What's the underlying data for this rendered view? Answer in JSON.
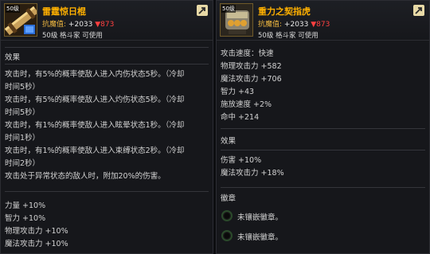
{
  "left": {
    "level_badge": "50级",
    "title": "雷霆惊日棍",
    "score_label": "抗魔值:",
    "score_up": "+2033",
    "score_down": "▼873",
    "requirement": "50级 格斗家 可使用",
    "effect_title": "效果",
    "effect_lines": [
      "攻击时，有5%的概率使敌人进入内伤状态5秒。（冷却",
      "时间5秒）",
      "攻击时，有5%的概率使敌人进入灼伤状态5秒。（冷却",
      "时间5秒）",
      "攻击时，有1%的概率使敌人进入眩晕状态1秒。（冷却",
      "时间1秒）",
      "攻击时，有1%的概率使敌人进入束缚状态2秒。（冷却",
      "时间2秒）",
      "攻击处于异常状态的敌人时，附加20%的伤害。"
    ],
    "stats": [
      "力量 +10%",
      "智力 +10%",
      "物理攻击力 +10%",
      "魔法攻击力 +10%"
    ]
  },
  "right": {
    "level_badge": "50级",
    "title": "重力之契指虎",
    "score_label": "抗魔值:",
    "score_up": "+2033",
    "score_down": "▼873",
    "requirement": "50级 格斗家 可使用",
    "stats": [
      "攻击速度：快速",
      "物理攻击力 +582",
      "魔法攻击力 +706",
      "智力 +43",
      "施放速度 +2%",
      "命中 +214"
    ],
    "effect_title": "效果",
    "effect_lines": [
      "伤害 +10%",
      "魔法攻击力 +18%"
    ],
    "emblem_title": "徽章",
    "sockets": [
      "未镶嵌徽章。",
      "未镶嵌徽章。"
    ]
  }
}
